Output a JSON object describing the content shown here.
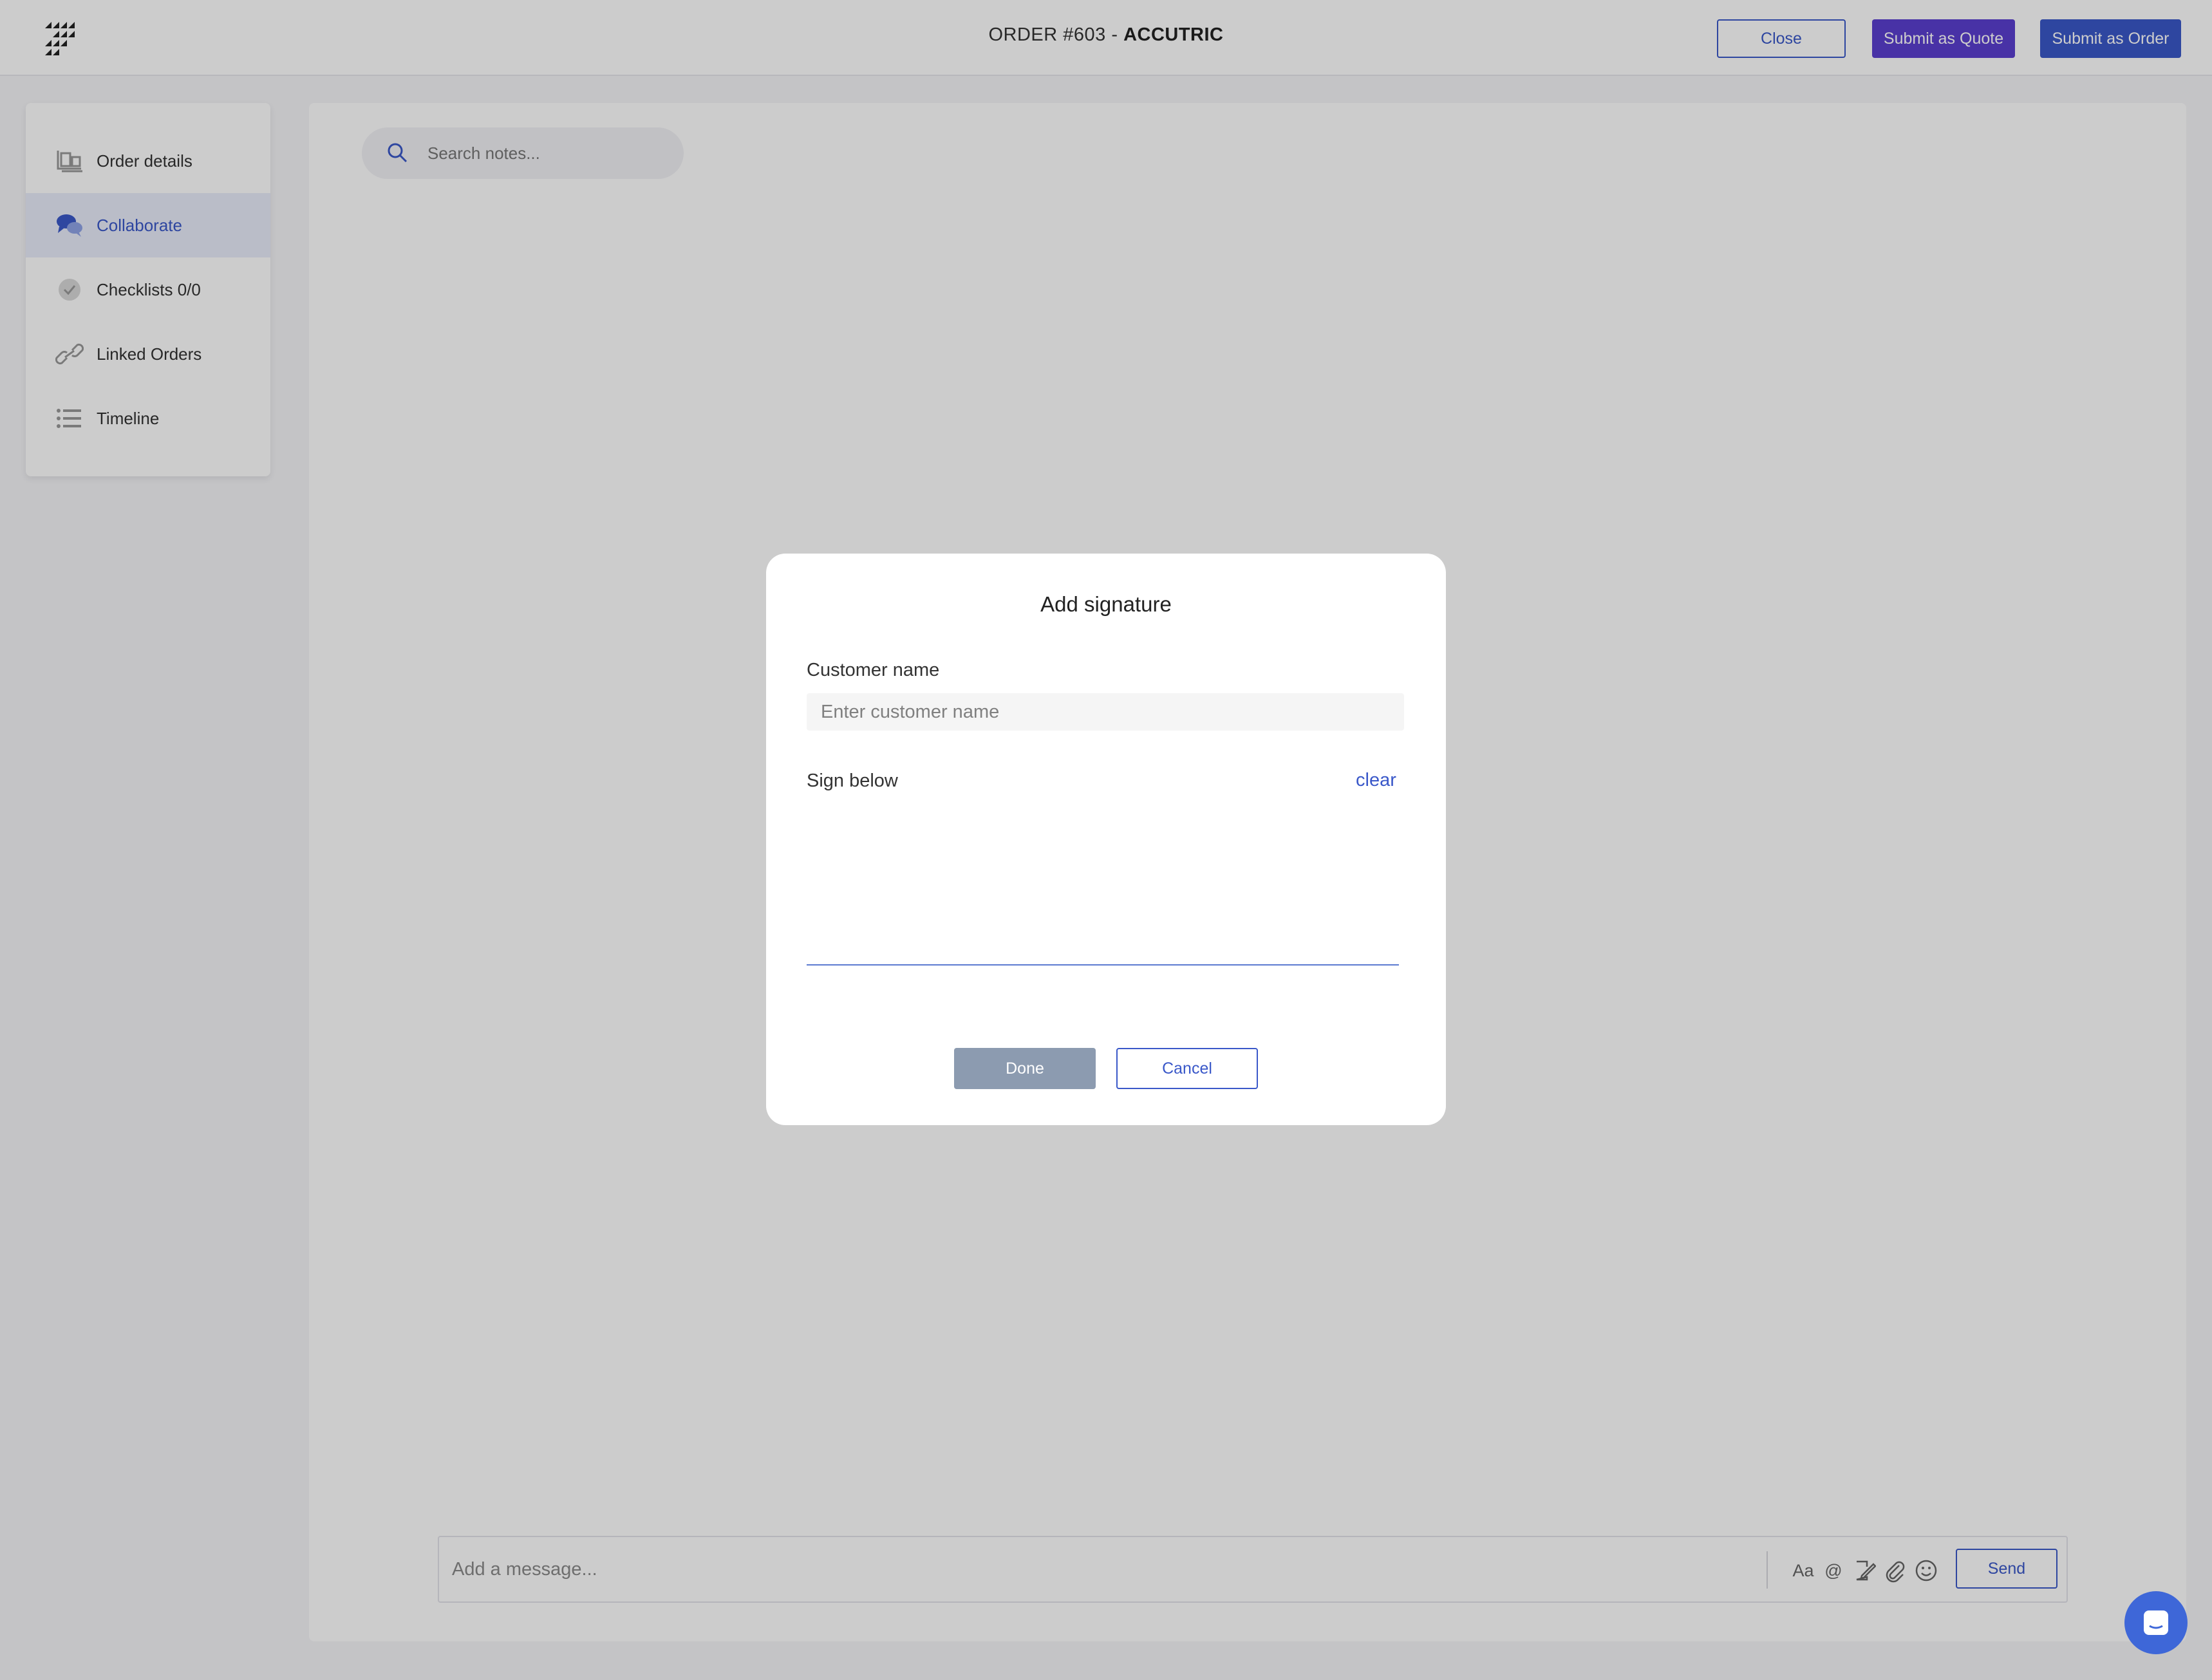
{
  "header": {
    "title_prefix": "ORDER #603 - ",
    "title_customer": "ACCUTRIC",
    "close_label": "Close",
    "submit_quote_label": "Submit as Quote",
    "submit_order_label": "Submit as Order"
  },
  "sidebar": {
    "items": [
      {
        "label": "Order details",
        "icon": "order-details-icon",
        "active": false
      },
      {
        "label": "Collaborate",
        "icon": "chat-bubbles-icon",
        "active": true
      },
      {
        "label": "Checklists 0/0",
        "icon": "checkmark-circle-icon",
        "active": false
      },
      {
        "label": "Linked Orders",
        "icon": "link-icon",
        "active": false
      },
      {
        "label": "Timeline",
        "icon": "list-icon",
        "active": false
      }
    ]
  },
  "notes": {
    "search_placeholder": "Search notes..."
  },
  "composer": {
    "placeholder": "Add a message...",
    "format_label": "Aa",
    "mention_label": "@",
    "send_label": "Send"
  },
  "modal": {
    "title": "Add signature",
    "customer_name_label": "Customer name",
    "customer_name_placeholder": "Enter customer name",
    "sign_label": "Sign below",
    "clear_label": "clear",
    "done_label": "Done",
    "cancel_label": "Cancel"
  },
  "colors": {
    "accent": "#3a58c9",
    "quote_button": "#5b3fd0",
    "done_button_disabled": "#8c9bb0",
    "chat_bubble": "#3e67d8"
  }
}
